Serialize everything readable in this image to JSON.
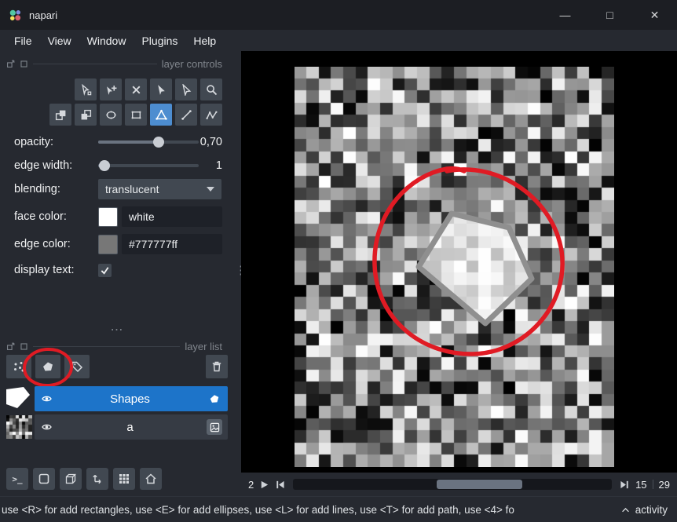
{
  "window": {
    "title": "napari",
    "controls": {
      "minimize": "—",
      "maximize": "□",
      "close": "✕"
    }
  },
  "menu": {
    "items": [
      "File",
      "View",
      "Window",
      "Plugins",
      "Help"
    ]
  },
  "icons": {
    "h_dots": "⋯",
    "v_dots": "⋮"
  },
  "layer_controls": {
    "title": "layer controls",
    "tools_row1": [
      "select-vertices",
      "vertex-insert",
      "vertex-remove",
      "select-shapes",
      "direct-select",
      "pan-zoom"
    ],
    "tools_row2": [
      "move-back",
      "move-front",
      "add-ellipse",
      "add-rectangle",
      "add-polygon",
      "add-line",
      "add-path"
    ],
    "active_tool": "add-polygon",
    "opacity_label": "opacity:",
    "opacity_value": "0,70",
    "opacity_percent": 60,
    "edge_width_label": "edge width:",
    "edge_width_value": "1",
    "edge_width_percent": 6,
    "blending_label": "blending:",
    "blending_value": "translucent",
    "face_color_label": "face color:",
    "face_color_value": "white",
    "face_color_hex": "#ffffff",
    "edge_color_label": "edge color:",
    "edge_color_value": "#777777ff",
    "edge_color_hex": "#777777",
    "display_text_label": "display text:",
    "display_text_checked": true
  },
  "layer_list": {
    "title": "layer list",
    "layers": [
      {
        "name": "Shapes",
        "type": "shapes",
        "selected": true
      },
      {
        "name": "a",
        "type": "image",
        "selected": false
      }
    ]
  },
  "dims": {
    "axis_label": "2",
    "current_step": "15",
    "total_steps": "29",
    "handle_left_percent": 45,
    "handle_width_percent": 27
  },
  "statusbar": {
    "message": "use <R> for add rectangles, use <E> for add ellipses, use <L> for add lines, use <T> for add path, use <4> fo",
    "activity": "activity"
  },
  "colors": {
    "selection_blue": "#1d74c9",
    "tool_active_blue": "#4d8dd0",
    "annotation_red": "#e01b24",
    "face_color": "#ffffff",
    "edge_color": "#777777"
  }
}
